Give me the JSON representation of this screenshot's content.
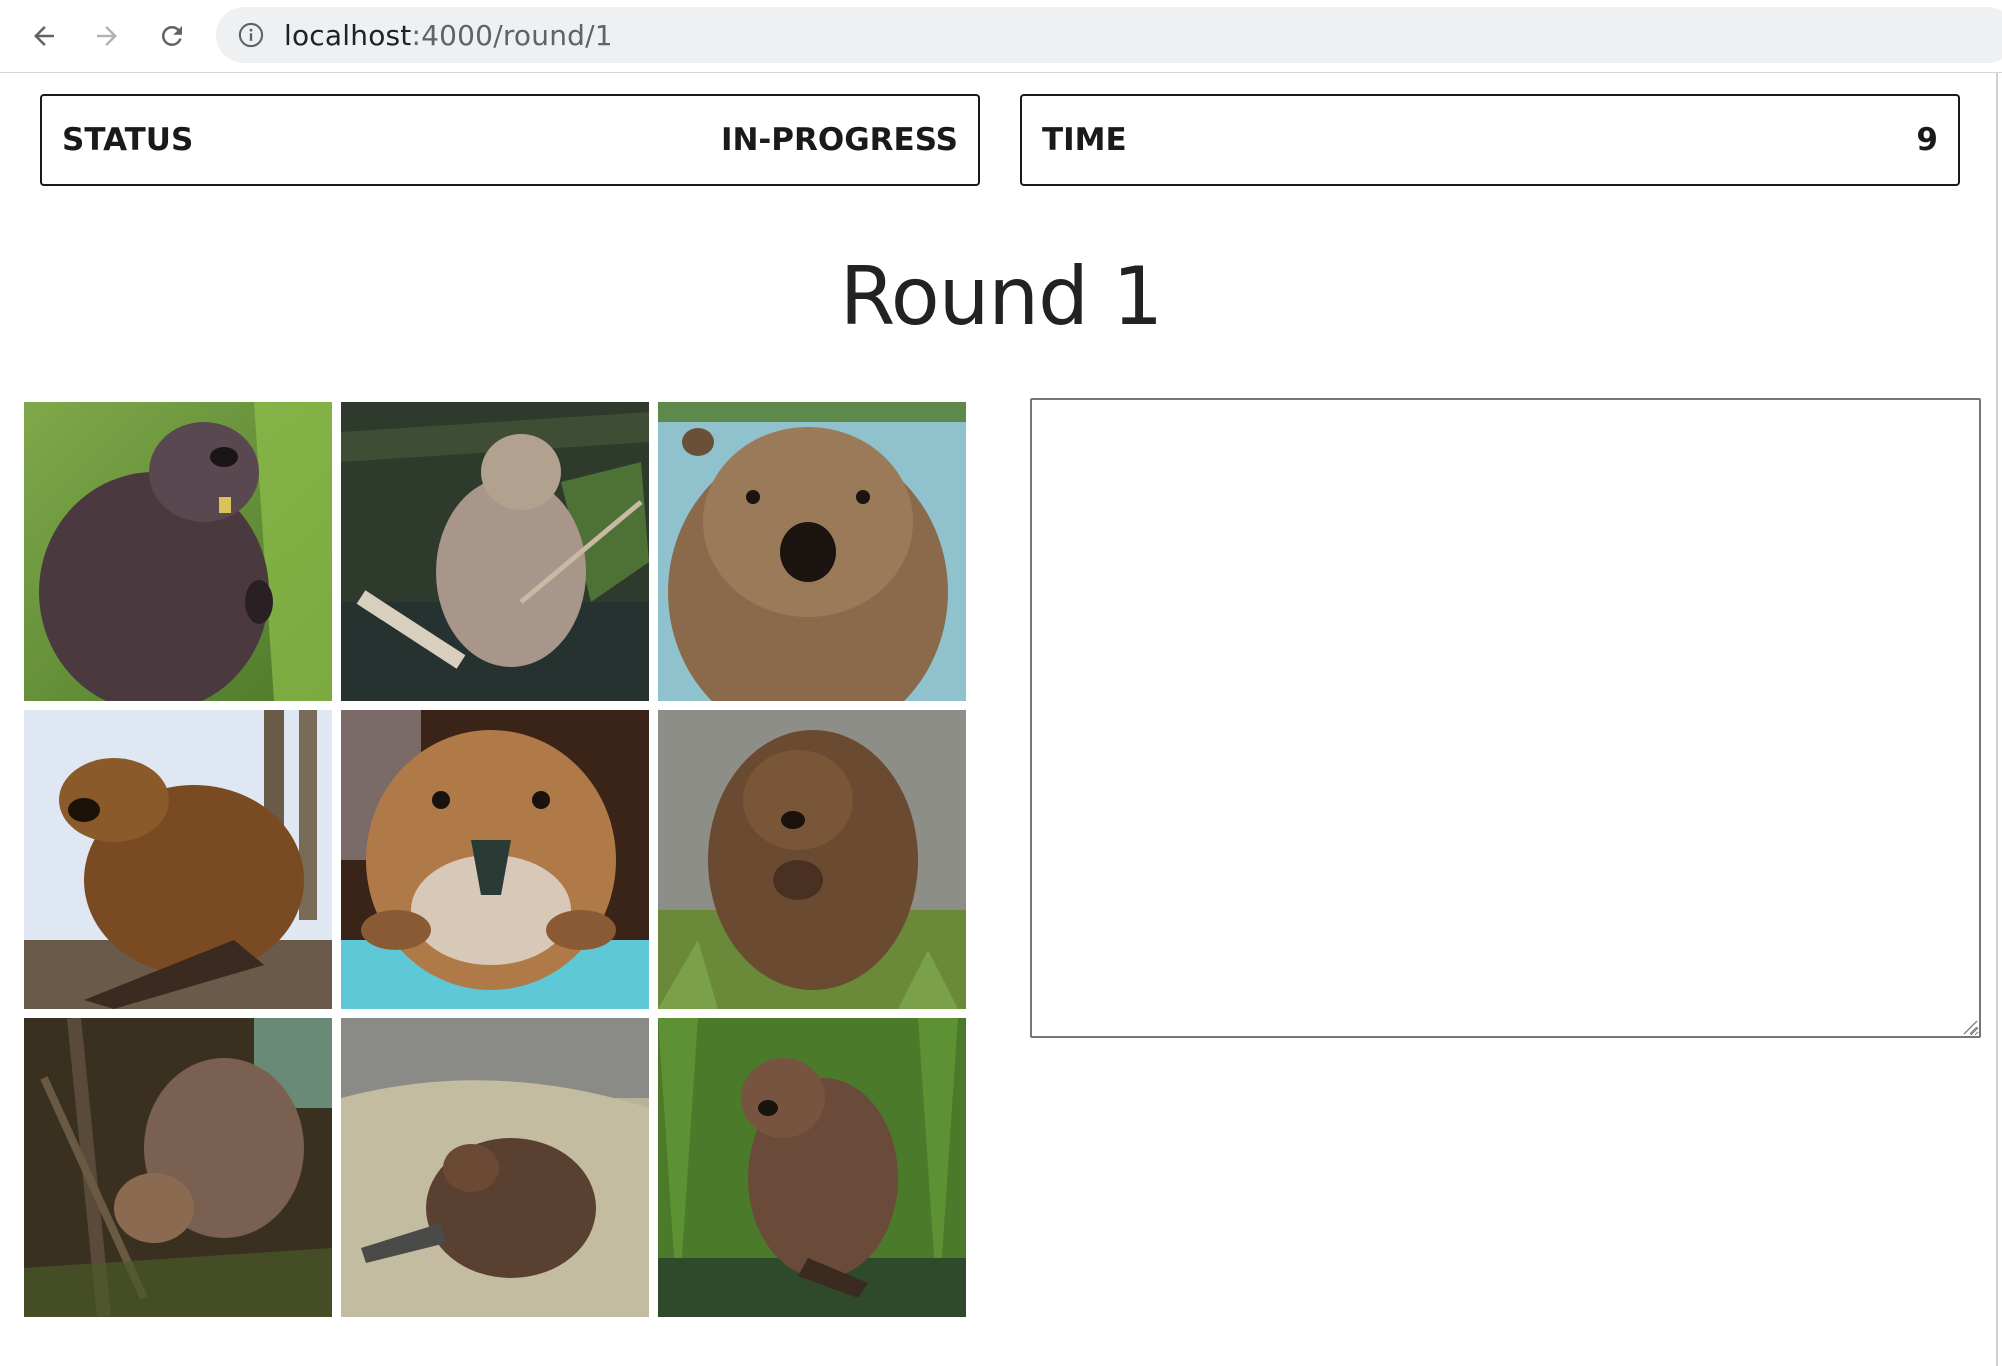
{
  "browser": {
    "url_host": "localhost",
    "url_path": ":4000/round/1"
  },
  "status_card": {
    "label": "STATUS",
    "value": "IN-PROGRESS"
  },
  "time_card": {
    "label": "TIME",
    "value": "9"
  },
  "title": "Round 1",
  "grid": {
    "images": [
      "beaver-standing-grass",
      "beaver-in-water-sticks",
      "beaver-face-closeup-blue",
      "beaver-eating-snow",
      "beaver-face-front-teal",
      "beaver-eating-grass",
      "beaver-on-dam",
      "beaver-on-hay",
      "beaver-in-tall-grass"
    ]
  },
  "answer": {
    "value": "",
    "placeholder": ""
  },
  "colors": {
    "border": "#1a1a1a",
    "omnibox": "#eef0f2",
    "text": "#222222"
  }
}
